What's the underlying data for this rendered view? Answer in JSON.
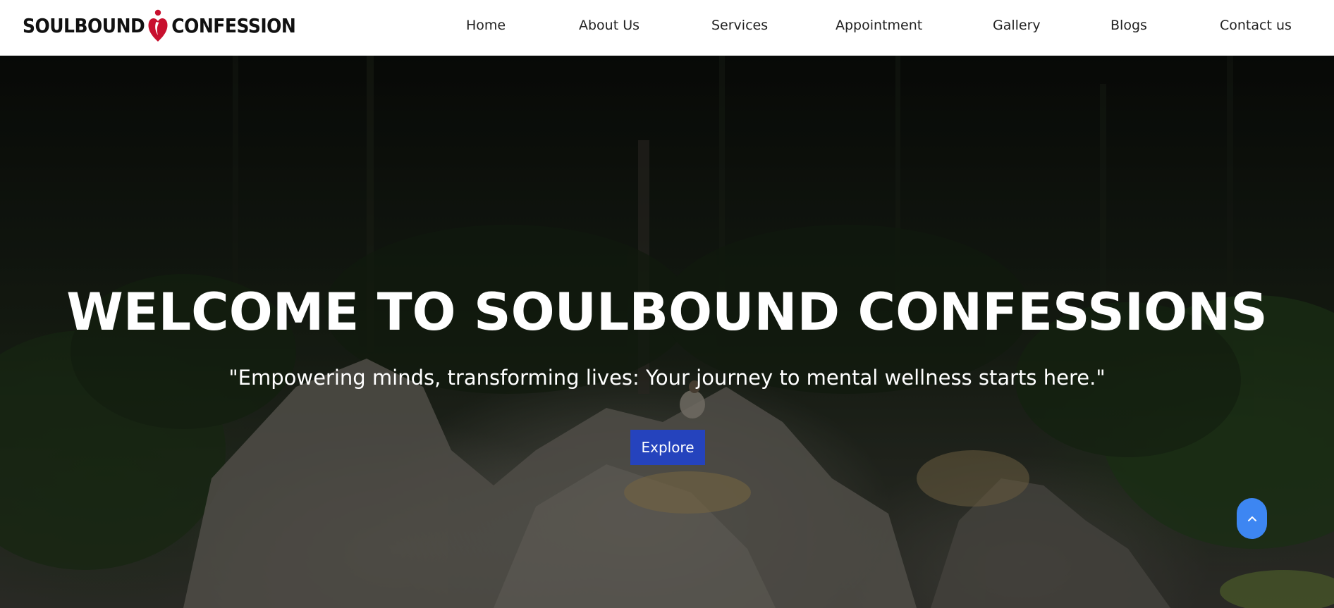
{
  "header": {
    "logo": {
      "left_text": "SOULBOUND",
      "right_text": "CONFESSION",
      "mark_icon": "heart-person-icon",
      "mark_color": "#c8102e"
    }
  },
  "nav": {
    "items": [
      {
        "label": "Home"
      },
      {
        "label": "About Us"
      },
      {
        "label": "Services"
      },
      {
        "label": "Appointment"
      },
      {
        "label": "Gallery"
      },
      {
        "label": "Blogs"
      },
      {
        "label": "Contact us"
      }
    ]
  },
  "hero": {
    "title": "WELCOME TO SOULBOUND CONFESSIONS",
    "tagline": "\"Empowering minds, transforming lives: Your journey to mental wellness starts here.\"",
    "cta_label": "Explore",
    "cta_color": "#2543bd"
  },
  "scroll_top": {
    "icon": "chevron-up-icon",
    "color": "#3d86f2"
  }
}
